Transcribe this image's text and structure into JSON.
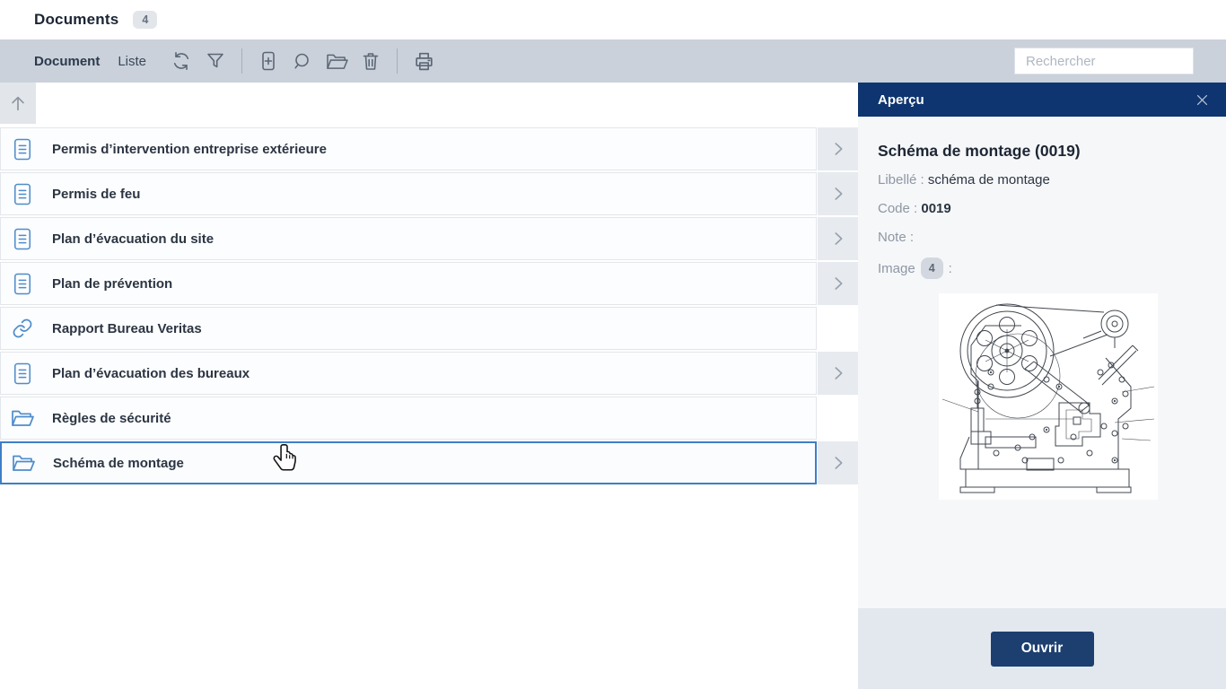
{
  "header": {
    "title": "Documents",
    "badge": "4"
  },
  "toolbar": {
    "tabs": [
      {
        "label": "Document",
        "active": true
      },
      {
        "label": "Liste",
        "active": false
      }
    ],
    "icons": [
      "refresh",
      "filter",
      "add-document",
      "search",
      "open-folder",
      "delete",
      "print"
    ],
    "search_placeholder": "Rechercher"
  },
  "list": {
    "up_icon": "arrow-up",
    "rows": [
      {
        "label": "Permis d’intervention entreprise extérieure",
        "icon": "document",
        "chevron": true,
        "selected": false
      },
      {
        "label": "Permis de feu",
        "icon": "document",
        "chevron": true,
        "selected": false
      },
      {
        "label": "Plan d’évacuation du site",
        "icon": "document",
        "chevron": true,
        "selected": false
      },
      {
        "label": "Plan de prévention",
        "icon": "document",
        "chevron": true,
        "selected": false
      },
      {
        "label": "Rapport Bureau Veritas",
        "icon": "link",
        "chevron": false,
        "selected": false
      },
      {
        "label": "Plan d’évacuation des bureaux",
        "icon": "document",
        "chevron": true,
        "selected": false
      },
      {
        "label": "Règles de sécurité",
        "icon": "folder",
        "chevron": false,
        "selected": false
      },
      {
        "label": "Schéma de montage",
        "icon": "folder",
        "chevron": true,
        "selected": true
      }
    ]
  },
  "preview": {
    "header": "Aperçu",
    "close_icon": "close-x",
    "title": "Schéma de montage (0019)",
    "libelle_label": "Libellé :",
    "libelle_value": "schéma de montage",
    "code_label": "Code :",
    "code_value": "0019",
    "note_label": "Note :",
    "image_label": "Image",
    "image_badge": "4",
    "image_colon": ":",
    "image_alt": "technical-machine-drawing",
    "open_button": "Ouvrir"
  },
  "colors": {
    "panel_header": "#0e356f",
    "toolbar_bg": "#cad1db",
    "accent_blue": "#4f8cca",
    "selected_border": "#3d7ec6",
    "open_button_bg": "#1c3f70",
    "footer_bg": "#e3e8ef"
  }
}
